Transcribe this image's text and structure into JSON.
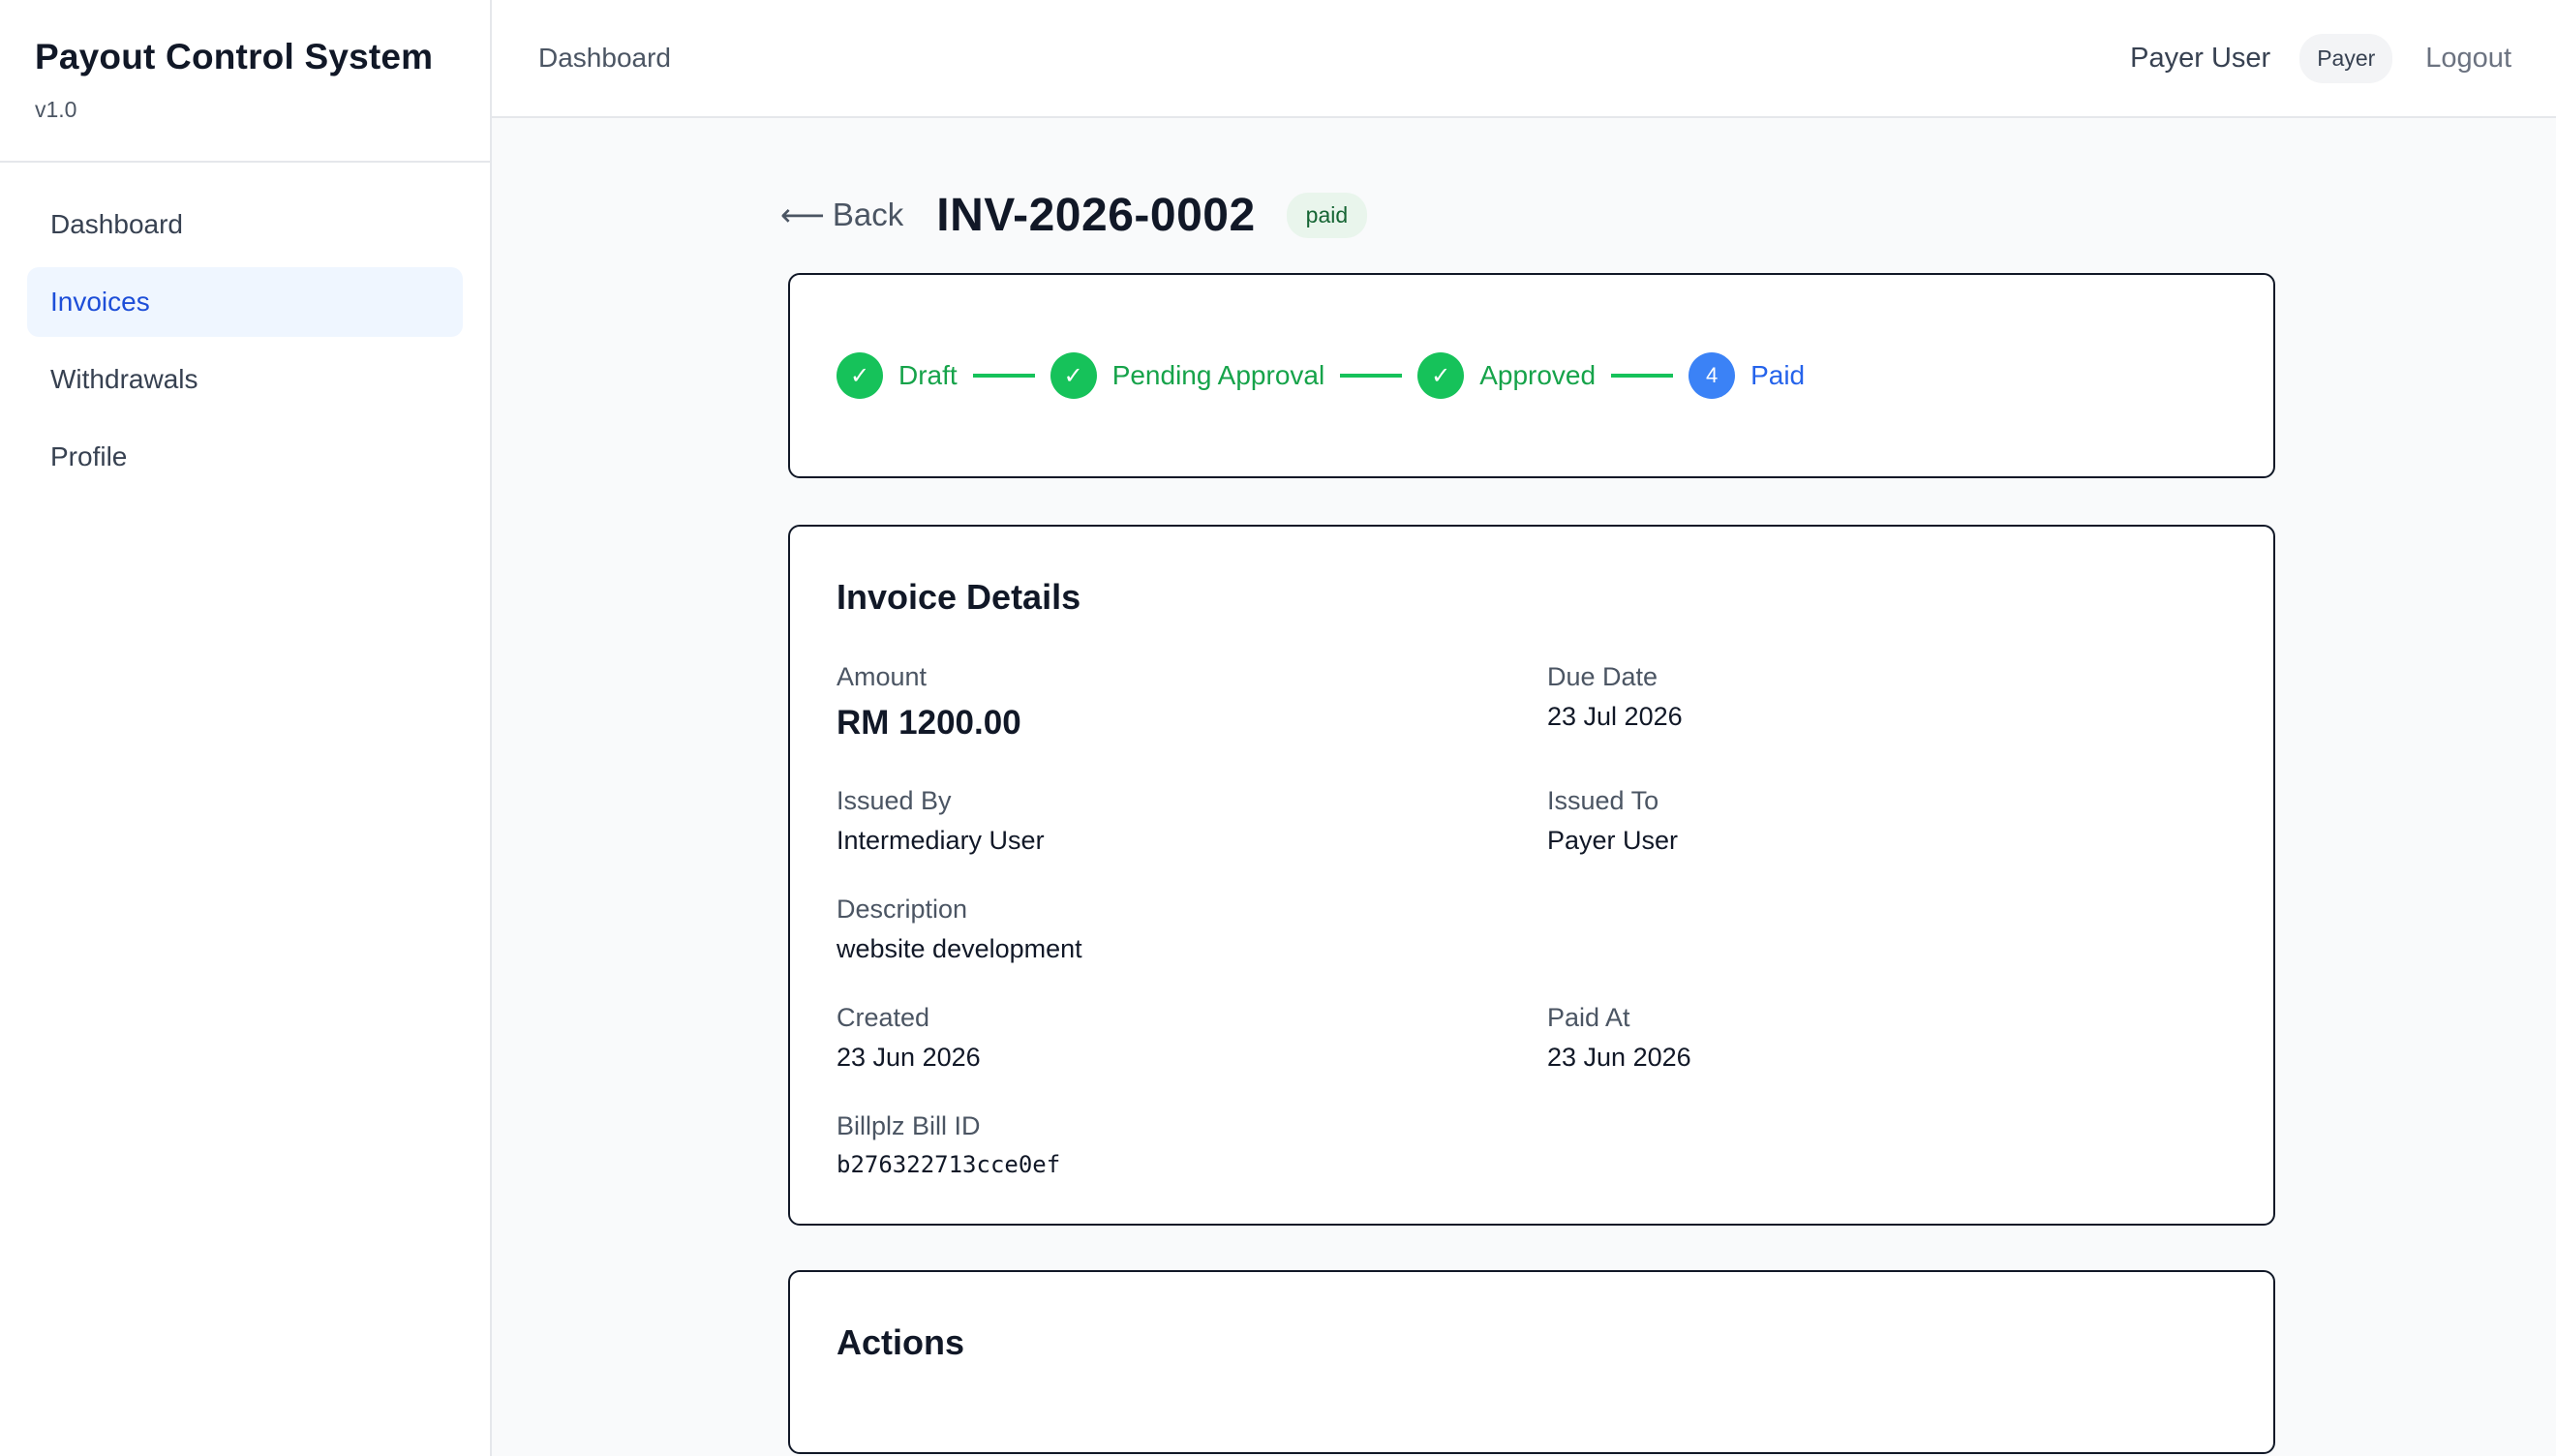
{
  "sidebar": {
    "app_title": "Payout Control System",
    "version": "v1.0",
    "items": [
      {
        "label": "Dashboard",
        "active": false
      },
      {
        "label": "Invoices",
        "active": true
      },
      {
        "label": "Withdrawals",
        "active": false
      },
      {
        "label": "Profile",
        "active": false
      }
    ]
  },
  "topbar": {
    "breadcrumb": "Dashboard",
    "user_name": "Payer User",
    "role": "Payer",
    "logout_label": "Logout"
  },
  "page": {
    "back_label": "Back",
    "back_icon": "arrow-left-icon",
    "invoice_number": "INV-2026-0002",
    "status": "paid"
  },
  "progress": {
    "steps": [
      {
        "label": "Draft",
        "state": "done",
        "marker": "✓"
      },
      {
        "label": "Pending Approval",
        "state": "done",
        "marker": "✓"
      },
      {
        "label": "Approved",
        "state": "done",
        "marker": "✓"
      },
      {
        "label": "Paid",
        "state": "current",
        "marker": "4"
      }
    ]
  },
  "details": {
    "title": "Invoice Details",
    "amount_label": "Amount",
    "amount_value": "RM 1200.00",
    "due_date_label": "Due Date",
    "due_date_value": "23 Jul 2026",
    "issued_by_label": "Issued By",
    "issued_by_value": "Intermediary User",
    "issued_to_label": "Issued To",
    "issued_to_value": "Payer User",
    "description_label": "Description",
    "description_value": "website development",
    "created_label": "Created",
    "created_value": "23 Jun 2026",
    "paid_at_label": "Paid At",
    "paid_at_value": "23 Jun 2026",
    "billplz_label": "Billplz Bill ID",
    "billplz_value": "b276322713cce0ef"
  },
  "actions": {
    "title": "Actions"
  },
  "colors": {
    "accent": "#2563eb",
    "success": "#16c25a",
    "active_nav_bg": "#eff6ff"
  }
}
